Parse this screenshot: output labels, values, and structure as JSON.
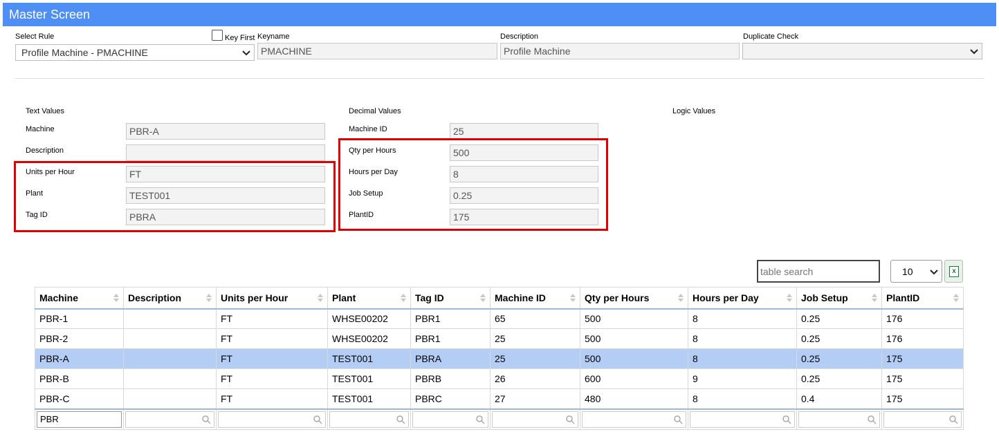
{
  "window": {
    "title": "Master Screen"
  },
  "header": {
    "select_rule_label": "Select Rule",
    "select_rule_value": "Profile Machine - PMACHINE",
    "key_first_label": "Key First",
    "keyname_label": "Keyname",
    "keyname_value": "PMACHINE",
    "description_label": "Description",
    "description_value": "Profile Machine",
    "duplicate_check_label": "Duplicate Check",
    "duplicate_check_value": ""
  },
  "text_values": {
    "heading": "Text Values",
    "fields": [
      {
        "label": "Machine",
        "value": "PBR-A"
      },
      {
        "label": "Description",
        "value": ""
      },
      {
        "label": "Units per Hour",
        "value": "FT"
      },
      {
        "label": "Plant",
        "value": "TEST001"
      },
      {
        "label": "Tag ID",
        "value": "PBRA"
      }
    ]
  },
  "decimal_values": {
    "heading": "Decimal Values",
    "fields": [
      {
        "label": "Machine ID",
        "value": "25"
      },
      {
        "label": "Qty per Hours",
        "value": "500"
      },
      {
        "label": "Hours per Day",
        "value": "8"
      },
      {
        "label": "Job Setup",
        "value": "0.25"
      },
      {
        "label": "PlantID",
        "value": "175"
      }
    ]
  },
  "logic_values": {
    "heading": "Logic Values"
  },
  "table_controls": {
    "search_placeholder": "table search",
    "page_size": "10",
    "excel_icon": "excel-export-icon"
  },
  "table": {
    "columns": [
      "Machine",
      "Description",
      "Units per Hour",
      "Plant",
      "Tag ID",
      "Machine ID",
      "Qty per Hours",
      "Hours per Day",
      "Job Setup",
      "PlantID"
    ],
    "rows": [
      [
        "PBR-1",
        "",
        "FT",
        "WHSE00202",
        "PBR1",
        "65",
        "500",
        "8",
        "0.25",
        "176"
      ],
      [
        "PBR-2",
        "",
        "FT",
        "WHSE00202",
        "PBR1",
        "25",
        "500",
        "8",
        "0.25",
        "176"
      ],
      [
        "PBR-A",
        "",
        "FT",
        "TEST001",
        "PBRA",
        "25",
        "500",
        "8",
        "0.25",
        "175"
      ],
      [
        "PBR-B",
        "",
        "FT",
        "TEST001",
        "PBRB",
        "26",
        "600",
        "9",
        "0.25",
        "175"
      ],
      [
        "PBR-C",
        "",
        "FT",
        "TEST001",
        "PBRC",
        "27",
        "480",
        "8",
        "0.4",
        "175"
      ]
    ],
    "selected_row": 2,
    "filters": [
      "PBR",
      "",
      "",
      "",
      "",
      "",
      "",
      "",
      "",
      ""
    ]
  },
  "colors": {
    "title_bar": "#4d8ff5",
    "highlight_box": "#e00000",
    "selected_row": "#b3cdf5"
  }
}
